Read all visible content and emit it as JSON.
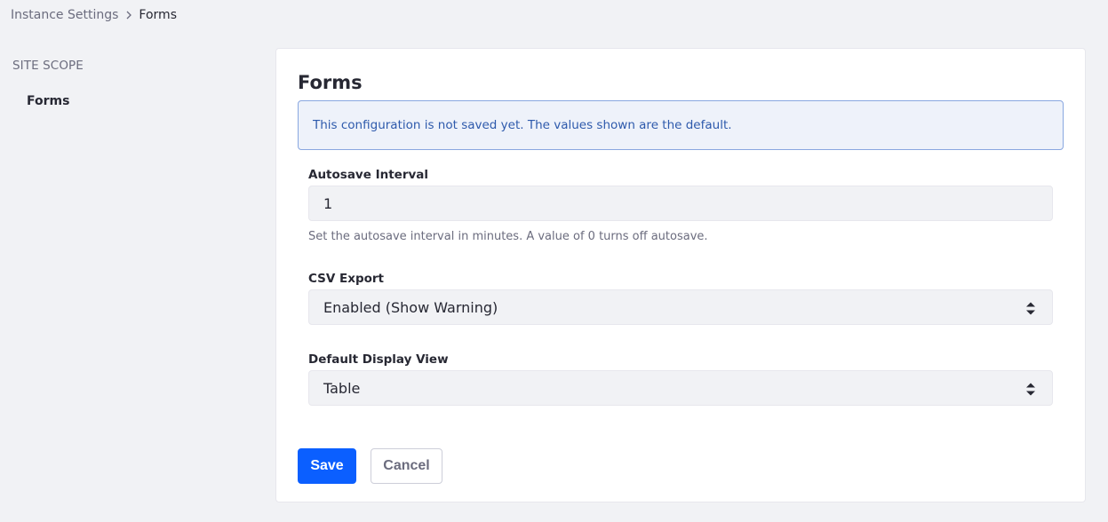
{
  "breadcrumb": {
    "parent": "Instance Settings",
    "current": "Forms"
  },
  "sidebar": {
    "scope_title": "SITE SCOPE",
    "items": [
      {
        "label": "Forms",
        "active": true
      }
    ]
  },
  "sheet": {
    "title": "Forms",
    "alert": "This configuration is not saved yet. The values shown are the default.",
    "fields": {
      "autosave": {
        "label": "Autosave Interval",
        "value": "1",
        "help": "Set the autosave interval in minutes. A value of 0 turns off autosave."
      },
      "csv_export": {
        "label": "CSV Export",
        "value": "Enabled (Show Warning)"
      },
      "default_view": {
        "label": "Default Display View",
        "value": "Table"
      }
    },
    "buttons": {
      "save": "Save",
      "cancel": "Cancel"
    }
  },
  "colors": {
    "primary": "#0b5fff",
    "alert_text": "#2e5aac",
    "alert_bg": "#eef2fa",
    "page_bg": "#f1f2f5"
  }
}
